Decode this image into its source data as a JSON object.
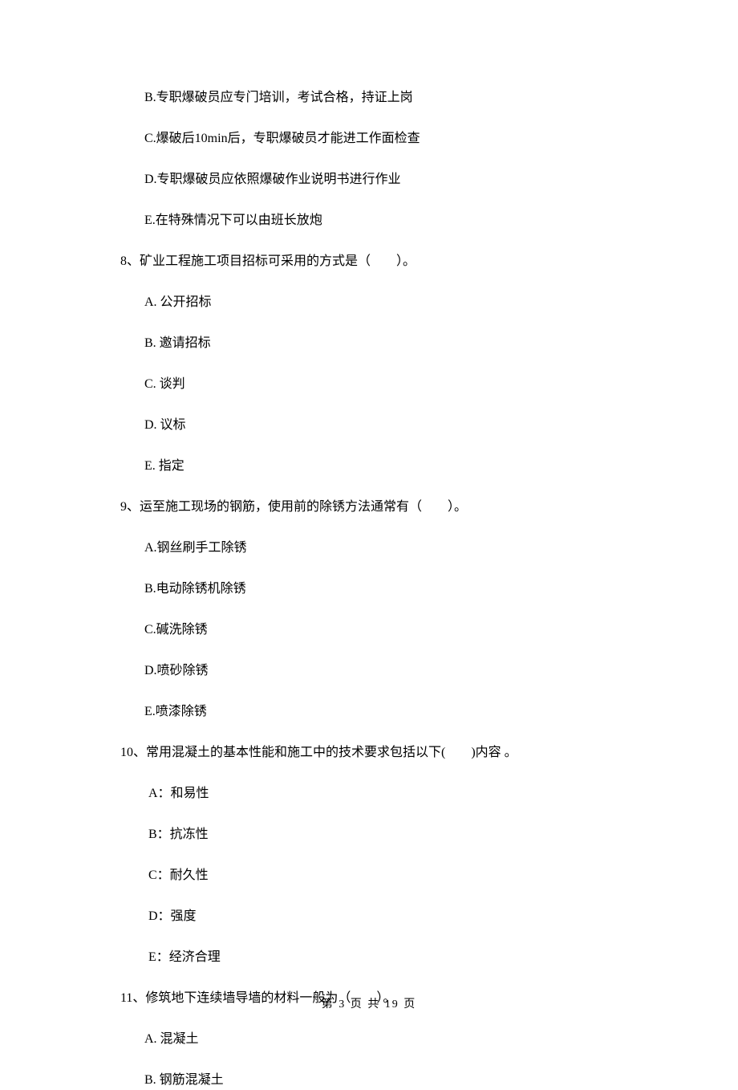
{
  "q7": {
    "options": {
      "b": "B.专职爆破员应专门培训，考试合格，持证上岗",
      "c": "C.爆破后10min后，专职爆破员才能进工作面检查",
      "d": "D.专职爆破员应依照爆破作业说明书进行作业",
      "e": "E.在特殊情况下可以由班长放炮"
    }
  },
  "q8": {
    "text": "8、矿业工程施工项目招标可采用的方式是（　　）。",
    "options": {
      "a": "A. 公开招标",
      "b": "B. 邀请招标",
      "c": "C. 谈判",
      "d": "D. 议标",
      "e": "E. 指定"
    }
  },
  "q9": {
    "text": "9、运至施工现场的钢筋，使用前的除锈方法通常有（　　）。",
    "options": {
      "a": "A.钢丝刷手工除锈",
      "b": "B.电动除锈机除锈",
      "c": "C.碱洗除锈",
      "d": "D.喷砂除锈",
      "e": "E.喷漆除锈"
    }
  },
  "q10": {
    "text": "10、常用混凝土的基本性能和施工中的技术要求包括以下(　　)内容 。",
    "options": {
      "a": "A：和易性",
      "b": "B：抗冻性",
      "c": "C：耐久性",
      "d": "D：强度",
      "e": "E：经济合理"
    }
  },
  "q11": {
    "text": "11、修筑地下连续墙导墙的材料一般为（　　）。",
    "options": {
      "a": "A. 混凝土",
      "b": "B. 钢筋混凝土"
    }
  },
  "footer": "第 3 页 共 19 页"
}
